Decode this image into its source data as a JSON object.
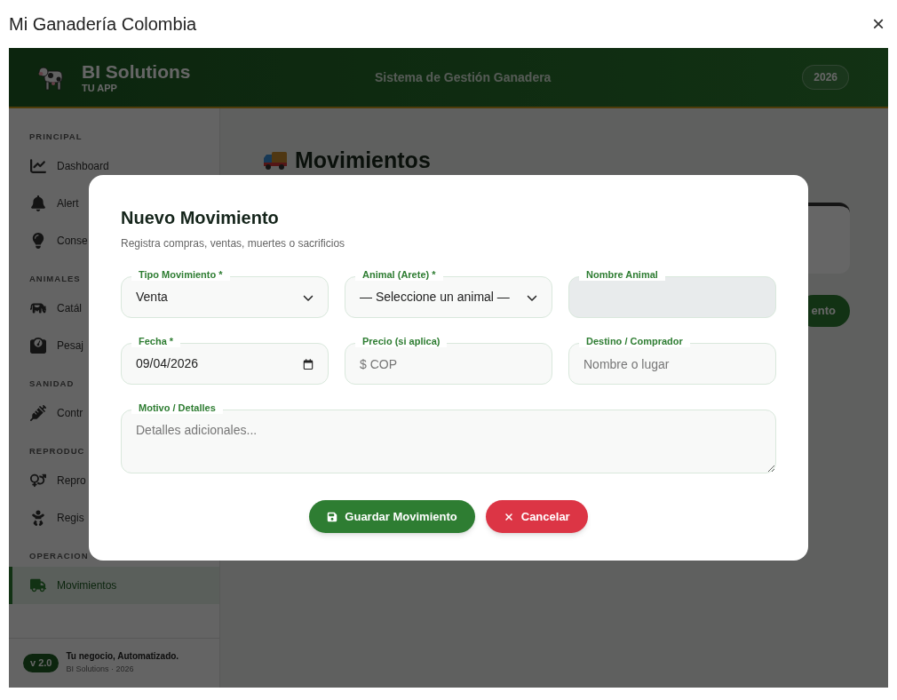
{
  "window": {
    "title": "Mi Ganadería Colombia",
    "close": "×"
  },
  "header": {
    "brand": "BI Solutions",
    "subtitle": "TU APP",
    "center": "Sistema de Gestión Ganadera",
    "year": "2026"
  },
  "sidebar": {
    "sections": [
      {
        "label": "PRINCIPAL",
        "items": [
          {
            "label": "Dashboard",
            "selected": false
          },
          {
            "label": "Alert",
            "selected": false
          },
          {
            "label": "Conse",
            "selected": false
          }
        ]
      },
      {
        "label": "ANIMALES",
        "items": [
          {
            "label": "Catál",
            "selected": false
          },
          {
            "label": "Pesaj",
            "selected": false
          }
        ]
      },
      {
        "label": "SANIDAD",
        "items": [
          {
            "label": "Contr",
            "selected": false
          }
        ]
      },
      {
        "label": "REPRODUC",
        "items": [
          {
            "label": "Repro",
            "selected": false
          },
          {
            "label": "Regis",
            "selected": false
          }
        ]
      },
      {
        "label": "OPERACION",
        "items": [
          {
            "label": "Movimientos",
            "selected": true
          }
        ]
      }
    ],
    "footer": {
      "version": "v 2.0",
      "tagline": "Tu negocio, Automatizado.",
      "credit": "BI Solutions · 2026"
    }
  },
  "page": {
    "title": "Movimientos",
    "button": "ento"
  },
  "modal": {
    "title": "Nuevo Movimiento",
    "subtitle": "Registra compras, ventas, muertes o sacrificios",
    "fields": [
      {
        "kind": "select",
        "label": "Tipo Movimiento *",
        "value": "Venta",
        "disabled": false
      },
      {
        "kind": "select",
        "label": "Animal (Arete) *",
        "value": "— Seleccione un animal —",
        "disabled": false
      },
      {
        "kind": "text",
        "label": "Nombre Animal",
        "disabled": true
      },
      {
        "kind": "date",
        "label": "Fecha *",
        "value": "09/04/2026",
        "disabled": false
      },
      {
        "kind": "text",
        "label": "Precio (si aplica)",
        "placeholder": "$ COP",
        "disabled": false
      },
      {
        "kind": "text",
        "label": "Destino / Comprador",
        "placeholder": "Nombre o lugar",
        "disabled": false
      },
      {
        "kind": "textarea",
        "label": "Motivo / Detalles",
        "placeholder": "Detalles adicionales...",
        "disabled": false
      }
    ],
    "buttons": [
      {
        "kind": "save",
        "label": "Guardar Movimiento"
      },
      {
        "kind": "cancel",
        "label": "Cancelar"
      }
    ]
  }
}
